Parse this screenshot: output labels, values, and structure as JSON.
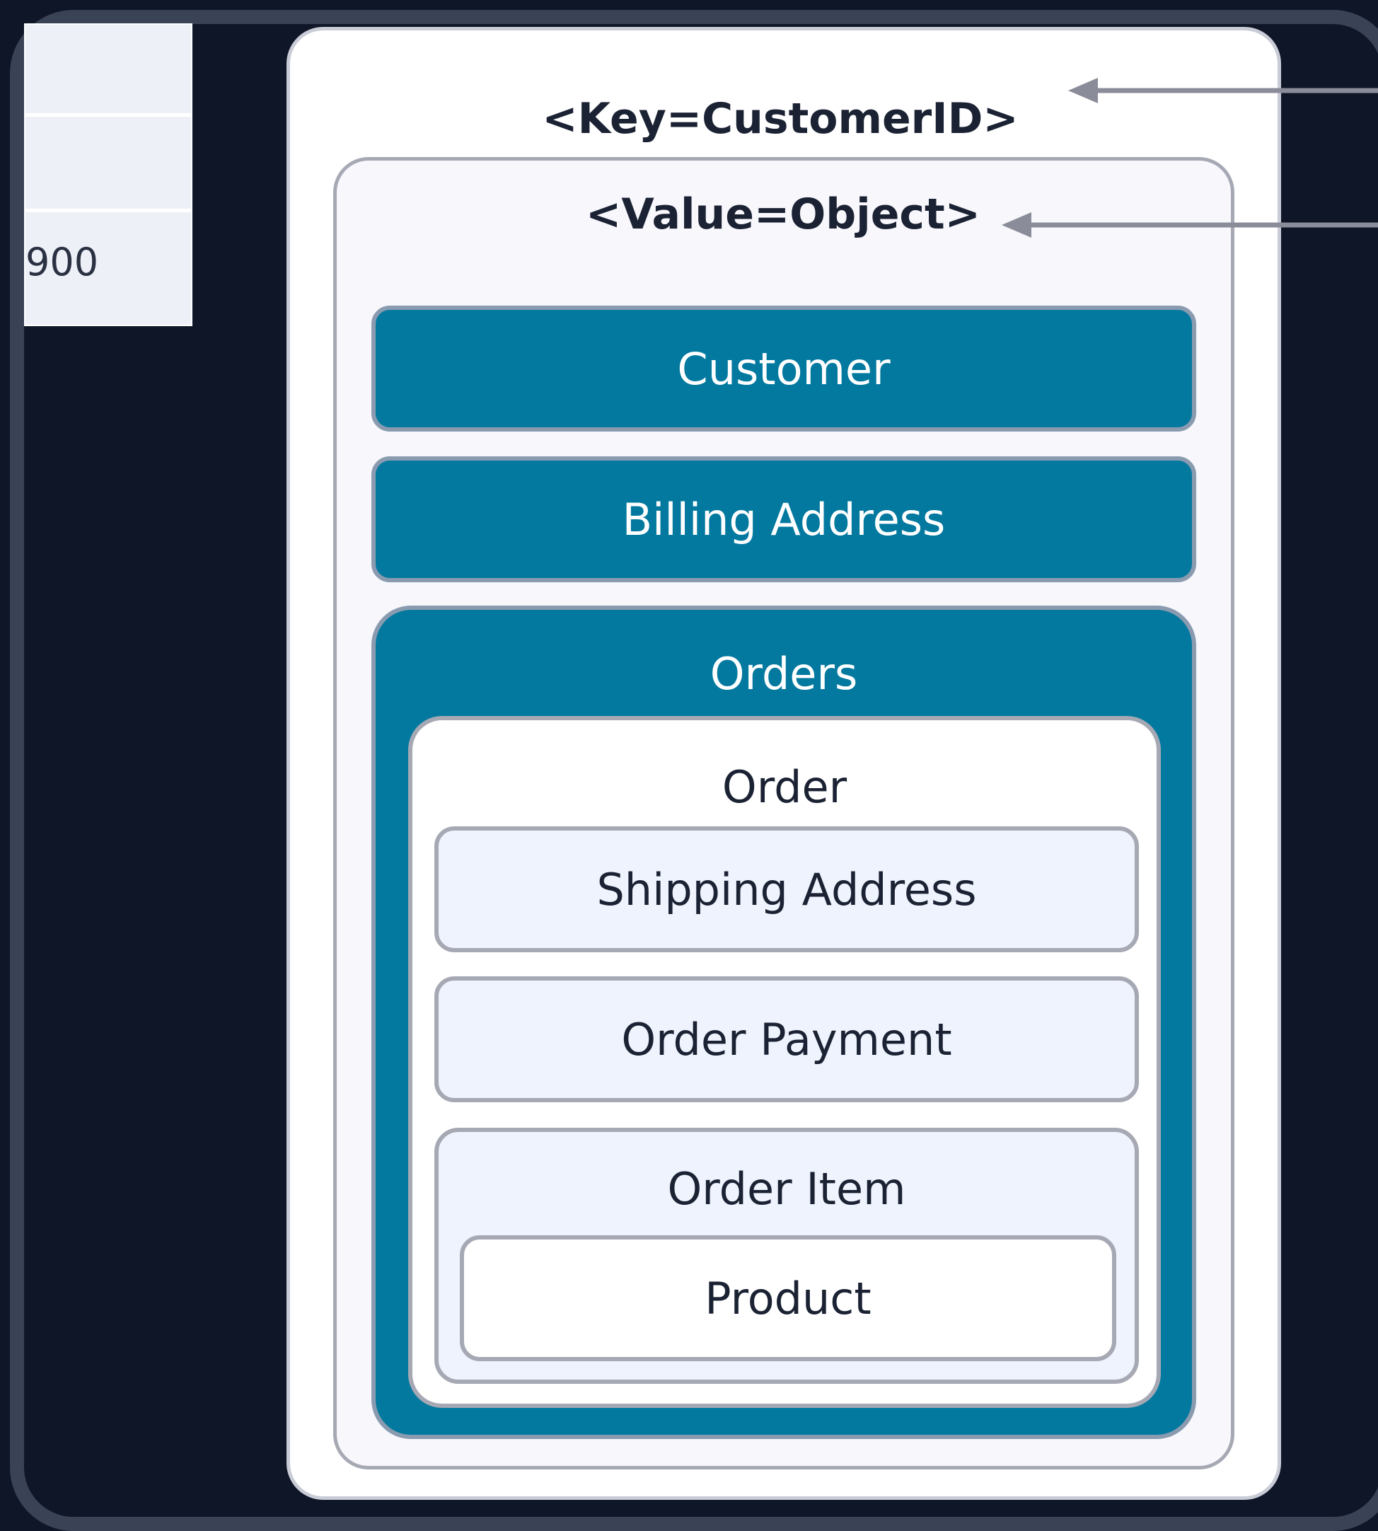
{
  "left_table": {
    "cells": [
      "",
      "",
      "900"
    ]
  },
  "diagram": {
    "key_label": "<Key=CustomerID>",
    "value_label": "<Value=Object>",
    "customer": "Customer",
    "billing_address": "Billing Address",
    "orders": "Orders",
    "order": "Order",
    "shipping_address": "Shipping Address",
    "order_payment": "Order Payment",
    "order_item": "Order Item",
    "product": "Product"
  },
  "colors": {
    "background": "#0f1628",
    "teal": "#03799f",
    "light_box": "#eef3fd",
    "arrow": "#8a8d99"
  }
}
